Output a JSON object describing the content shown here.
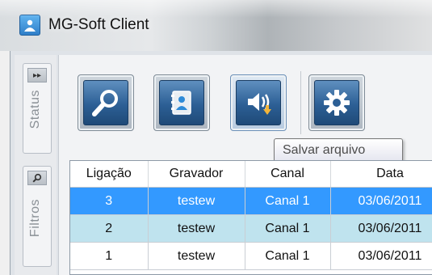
{
  "window": {
    "title": "MG-Soft Client"
  },
  "side_tabs": [
    {
      "label": "Status",
      "pin_icon": "double-chevron-right-icon"
    },
    {
      "label": "Filtros",
      "pin_icon": "magnifier-icon"
    }
  ],
  "toolbar": {
    "buttons": [
      {
        "name": "search",
        "icon": "magnifier-icon"
      },
      {
        "name": "contacts",
        "icon": "address-book-icon"
      },
      {
        "name": "save-file",
        "icon": "speaker-download-icon"
      },
      {
        "name": "settings",
        "icon": "gear-icon"
      }
    ],
    "tooltip": "Salvar arquivo"
  },
  "grid": {
    "columns": [
      "Ligação",
      "Gravador",
      "Canal",
      "Data"
    ],
    "rows": [
      {
        "ligacao": "3",
        "gravador": "testew",
        "canal": "Canal 1",
        "data": "03/06/2011",
        "state": "selected"
      },
      {
        "ligacao": "2",
        "gravador": "testew",
        "canal": "Canal 1",
        "data": "03/06/2011",
        "state": "alternate"
      },
      {
        "ligacao": "1",
        "gravador": "testew",
        "canal": "Canal 1",
        "data": "03/06/2011",
        "state": "normal"
      }
    ]
  },
  "colors": {
    "selection": "#3399ff",
    "alternate_row": "#bfe3ee",
    "button_blue": "#2c5f95"
  }
}
